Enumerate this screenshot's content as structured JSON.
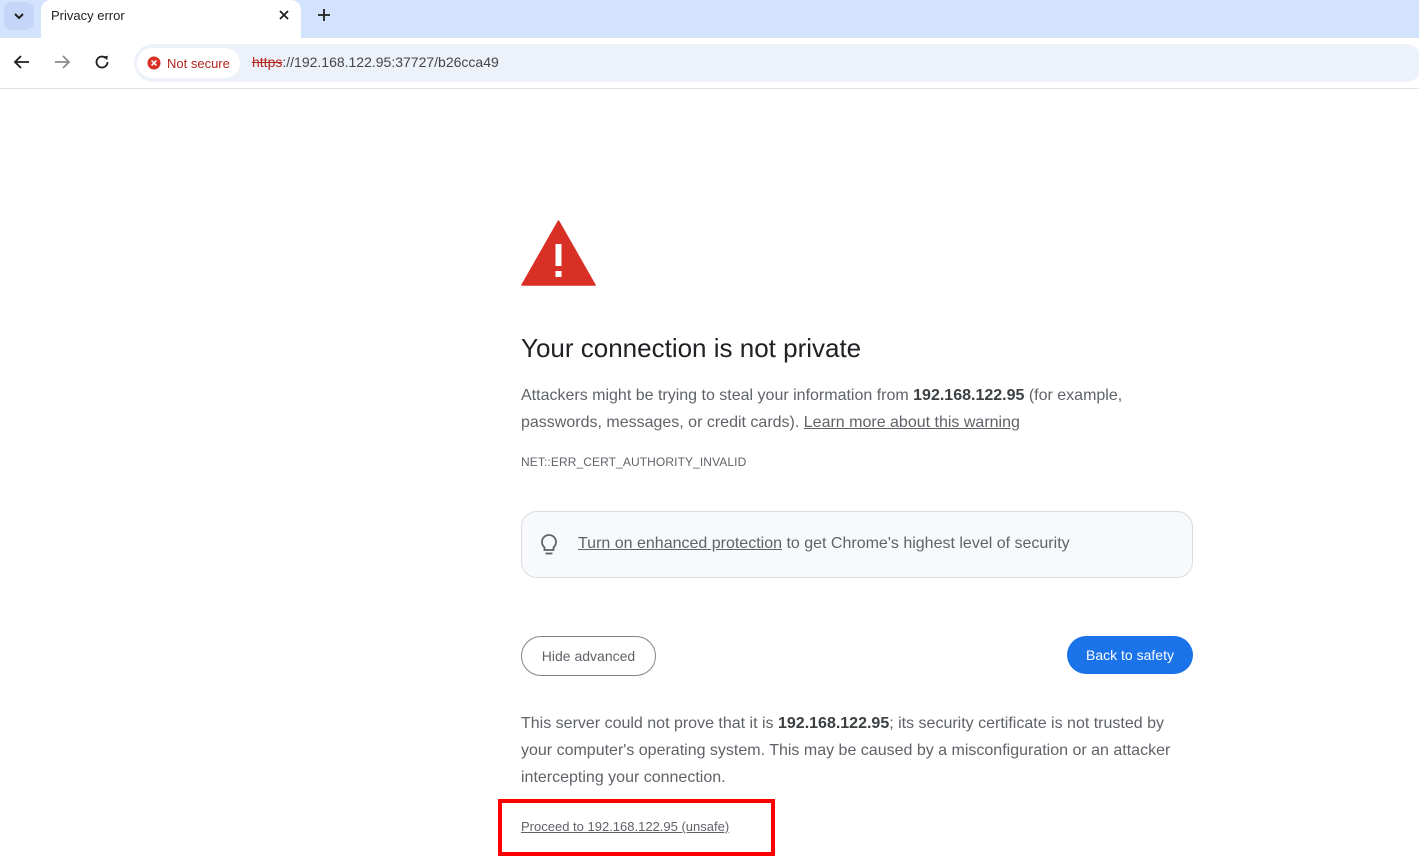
{
  "browser": {
    "tab_title": "Privacy error",
    "security_chip_label": "Not secure",
    "url_scheme": "https",
    "url_rest": "://192.168.122.95:37727/b26cca49",
    "icons": [
      "tab-search-icon",
      "close-icon",
      "plus-icon",
      "back-arrow-icon",
      "forward-arrow-icon",
      "reload-icon",
      "error-circle-icon"
    ]
  },
  "interstitial": {
    "heading": "Your connection is not private",
    "explanation_prefix": "Attackers might be trying to steal your information from ",
    "host": "192.168.122.95",
    "explanation_suffix": " (for example, passwords, messages, or credit cards). ",
    "learn_more_link": "Learn more about this warning",
    "error_code": "NET::ERR_CERT_AUTHORITY_INVALID",
    "promo_link": "Turn on enhanced protection",
    "promo_suffix": " to get Chrome's highest level of security",
    "hide_advanced_button": "Hide advanced",
    "back_to_safety_button": "Back to safety",
    "details_prefix": "This server could not prove that it is ",
    "details_host": "192.168.122.95",
    "details_suffix": "; its security certificate is not trusted by your computer's operating system. This may be caused by a misconfiguration or an attacker intercepting your connection.",
    "proceed_link": "Proceed to 192.168.122.95 (unsafe)"
  },
  "colors": {
    "tabstrip_bg": "#d3e3fd",
    "danger_red": "#d93025",
    "primary_blue": "#1a73e8",
    "annotation_red": "#ff0000"
  }
}
